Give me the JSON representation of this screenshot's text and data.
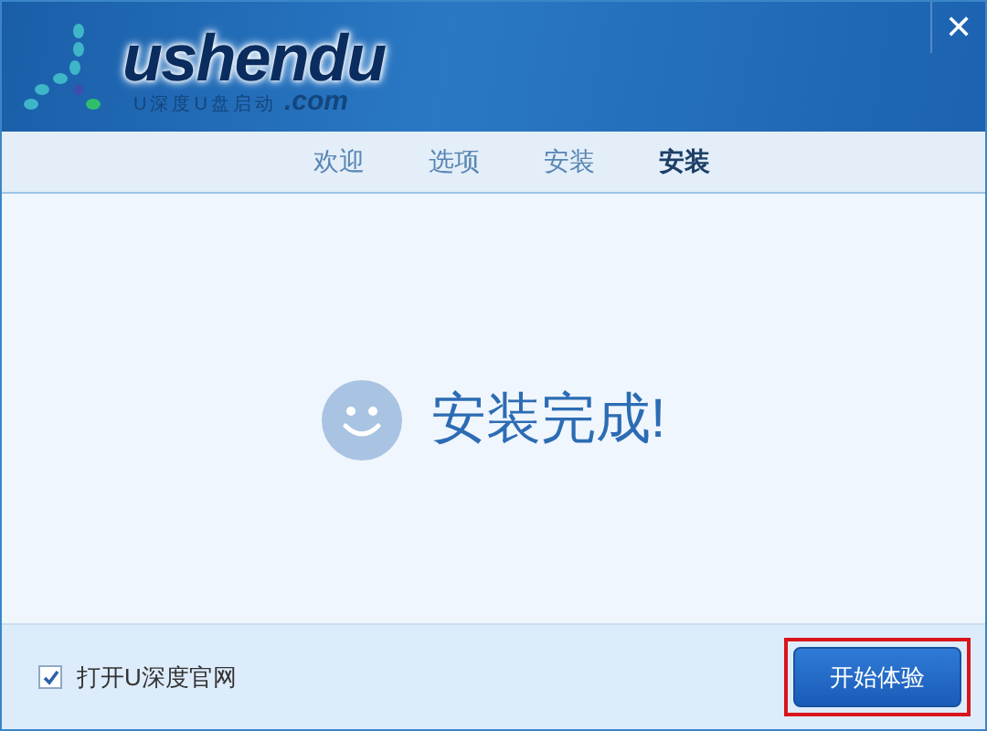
{
  "logo": {
    "name": "ushendu",
    "domain": ".com",
    "tagline": "U深度U盘启动"
  },
  "close_button": {
    "label": "✕"
  },
  "tabs": [
    {
      "label": "欢迎",
      "selected": false
    },
    {
      "label": "选项",
      "selected": false
    },
    {
      "label": "安装",
      "selected": false
    },
    {
      "label": "安装",
      "selected": true
    }
  ],
  "message": "安装完成!",
  "option": {
    "label": "打开U深度官网",
    "checked": true
  },
  "start_button": {
    "label": "开始体验",
    "highlighted": true
  }
}
